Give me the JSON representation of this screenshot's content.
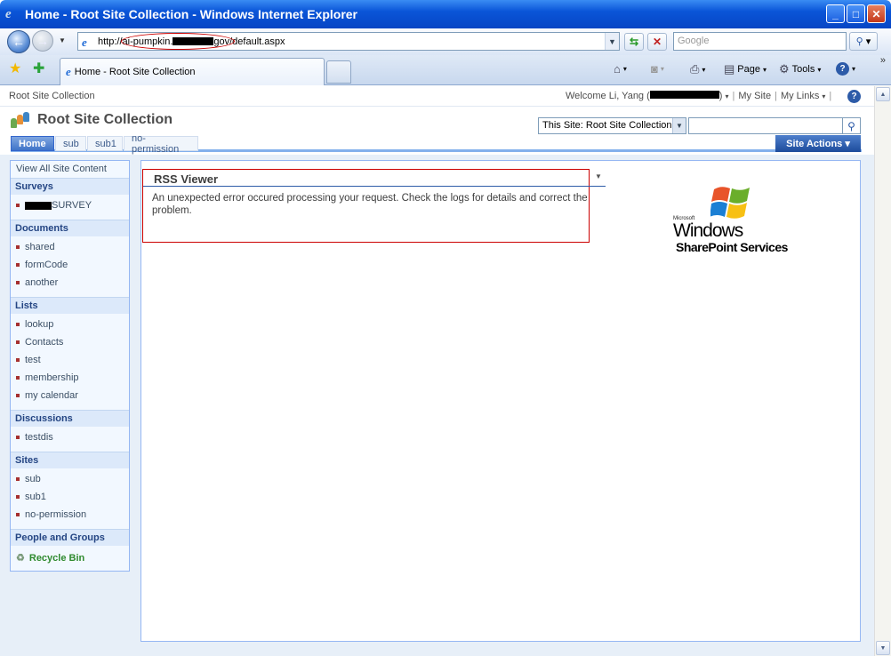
{
  "window": {
    "title": "Home - Root Site Collection - Windows Internet Explorer"
  },
  "address_bar": {
    "url_prefix": "http://ai-pumpkin.",
    "url_suffix": "gov/default.aspx",
    "search_placeholder": "Google"
  },
  "tab": {
    "label": "Home - Root Site Collection"
  },
  "command_bar": {
    "page_label": "Page",
    "tools_label": "Tools"
  },
  "header": {
    "breadcrumb": "Root Site Collection",
    "welcome_prefix": "Welcome Li, Yang (",
    "welcome_suffix": ")",
    "my_site": "My Site",
    "my_links": "My Links",
    "site_title": "Root Site Collection",
    "search_scope": "This Site: Root Site Collection"
  },
  "top_nav": {
    "tabs": [
      "Home",
      "sub",
      "sub1",
      "no-permission"
    ],
    "site_actions": "Site Actions"
  },
  "quick_launch": {
    "view_all": "View All Site Content",
    "sections": [
      {
        "title": "Surveys",
        "items": [
          "SURVEY"
        ]
      },
      {
        "title": "Documents",
        "items": [
          "shared",
          "formCode",
          "another"
        ]
      },
      {
        "title": "Lists",
        "items": [
          "lookup",
          "Contacts",
          "test",
          "membership",
          "my calendar"
        ]
      },
      {
        "title": "Discussions",
        "items": [
          "testdis"
        ]
      },
      {
        "title": "Sites",
        "items": [
          "sub",
          "sub1",
          "no-permission"
        ]
      },
      {
        "title": "People and Groups",
        "items": []
      }
    ],
    "recycle_bin": "Recycle Bin"
  },
  "web_part": {
    "title": "RSS Viewer",
    "error": "An unexpected error occured processing your request. Check the logs for details and correct the problem."
  },
  "logo": {
    "microsoft": "Microsoft",
    "windows": "Windows",
    "product": "SharePoint Services"
  }
}
